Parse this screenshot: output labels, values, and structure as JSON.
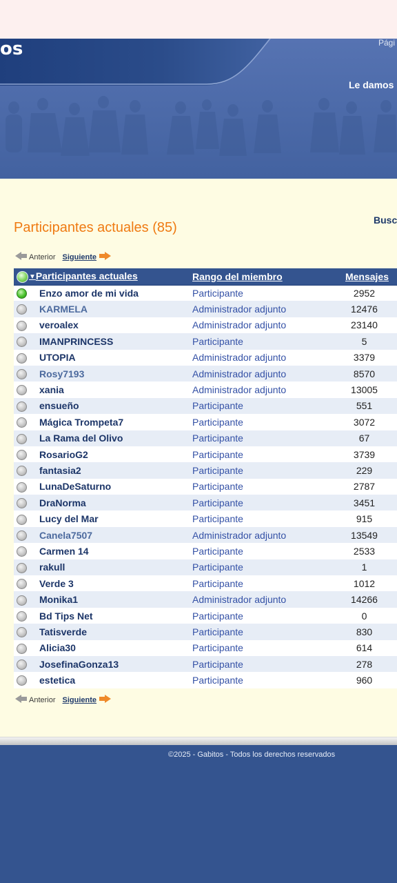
{
  "header": {
    "logo_fragment": "os",
    "top_right_fragment": "Pági",
    "welcome_fragment": "Le damos"
  },
  "main": {
    "title": "Participantes actuales (85)",
    "search_fragment": "Busc",
    "pager": {
      "previous": "Anterior",
      "next": "Siguiente"
    }
  },
  "table": {
    "headers": {
      "name": "Participantes actuales",
      "rank": "Rango del miembro",
      "posts": "Mensajes"
    },
    "rows": [
      {
        "name": "Enzo amor de mi vida",
        "rank": "Participante",
        "posts": "2952",
        "online": true,
        "name_style": "normal"
      },
      {
        "name": "KARMELA",
        "rank": "Administrador adjunto",
        "posts": "12476",
        "online": false,
        "name_style": "alt"
      },
      {
        "name": "veroalex",
        "rank": "Administrador adjunto",
        "posts": "23140",
        "online": false,
        "name_style": "normal"
      },
      {
        "name": "IMANPRINCESS",
        "rank": "Participante",
        "posts": "5",
        "online": false,
        "name_style": "normal"
      },
      {
        "name": "UTOPIA",
        "rank": "Administrador adjunto",
        "posts": "3379",
        "online": false,
        "name_style": "normal"
      },
      {
        "name": "Rosy7193",
        "rank": "Administrador adjunto",
        "posts": "8570",
        "online": false,
        "name_style": "alt"
      },
      {
        "name": "xania",
        "rank": "Administrador adjunto",
        "posts": "13005",
        "online": false,
        "name_style": "normal"
      },
      {
        "name": "ensueño",
        "rank": "Participante",
        "posts": "551",
        "online": false,
        "name_style": "normal"
      },
      {
        "name": "Mágica Trompeta7",
        "rank": "Participante",
        "posts": "3072",
        "online": false,
        "name_style": "normal"
      },
      {
        "name": "La Rama del Olivo",
        "rank": "Participante",
        "posts": "67",
        "online": false,
        "name_style": "normal"
      },
      {
        "name": "RosarioG2",
        "rank": "Participante",
        "posts": "3739",
        "online": false,
        "name_style": "normal"
      },
      {
        "name": "fantasia2",
        "rank": "Participante",
        "posts": "229",
        "online": false,
        "name_style": "normal"
      },
      {
        "name": "LunaDeSaturno",
        "rank": "Participante",
        "posts": "2787",
        "online": false,
        "name_style": "normal"
      },
      {
        "name": "DraNorma",
        "rank": "Participante",
        "posts": "3451",
        "online": false,
        "name_style": "normal"
      },
      {
        "name": "Lucy del Mar",
        "rank": "Participante",
        "posts": "915",
        "online": false,
        "name_style": "normal"
      },
      {
        "name": "Canela7507",
        "rank": "Administrador adjunto",
        "posts": "13549",
        "online": false,
        "name_style": "alt"
      },
      {
        "name": "Carmen 14",
        "rank": "Participante",
        "posts": "2533",
        "online": false,
        "name_style": "normal"
      },
      {
        "name": "rakull",
        "rank": "Participante",
        "posts": "1",
        "online": false,
        "name_style": "normal"
      },
      {
        "name": "Verde 3",
        "rank": "Participante",
        "posts": "1012",
        "online": false,
        "name_style": "normal"
      },
      {
        "name": "Monika1",
        "rank": "Administrador adjunto",
        "posts": "14266",
        "online": false,
        "name_style": "normal"
      },
      {
        "name": "Bd Tips Net",
        "rank": "Participante",
        "posts": "0",
        "online": false,
        "name_style": "normal"
      },
      {
        "name": "Tatisverde",
        "rank": "Participante",
        "posts": "830",
        "online": false,
        "name_style": "normal"
      },
      {
        "name": "Alicia30",
        "rank": "Participante",
        "posts": "614",
        "online": false,
        "name_style": "normal"
      },
      {
        "name": "JosefinaGonza13",
        "rank": "Participante",
        "posts": "278",
        "online": false,
        "name_style": "normal"
      },
      {
        "name": "estetica",
        "rank": "Participante",
        "posts": "960",
        "online": false,
        "name_style": "normal"
      }
    ]
  },
  "footer": {
    "copyright": "©2025 - Gabitos - Todos los derechos reservados"
  },
  "colors": {
    "brand_blue": "#34548f",
    "title_orange": "#ef7a12",
    "content_bg": "#fefce3"
  },
  "icons": {
    "status_online": "green-dot-icon",
    "status_offline": "grey-dot-icon",
    "sort": "sort-down-arrow-icon",
    "previous": "arrow-left-icon",
    "next": "arrow-right-icon"
  }
}
